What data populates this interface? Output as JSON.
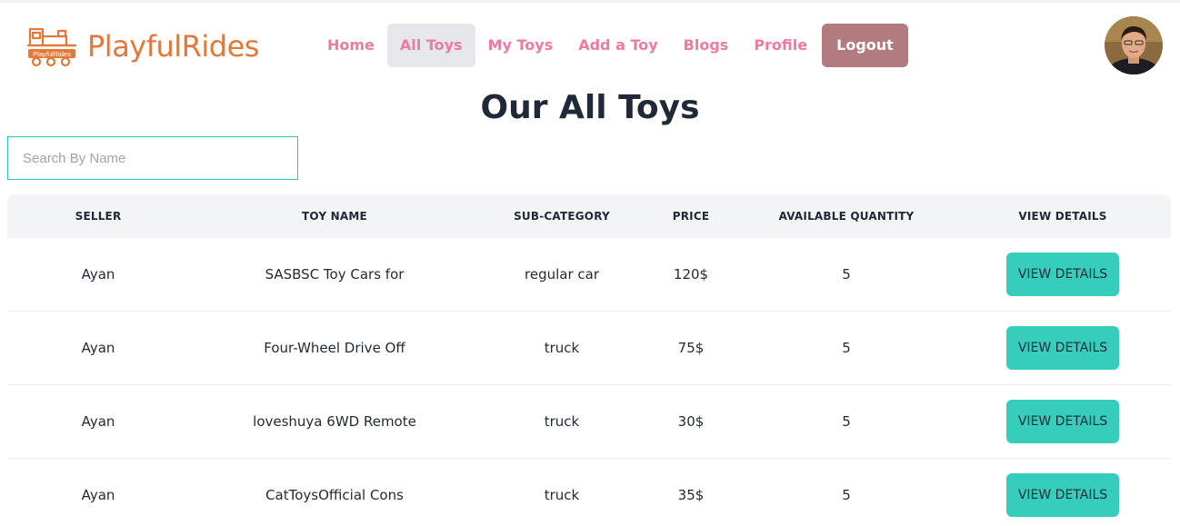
{
  "brand": {
    "name": "PlayfulRides",
    "logo_text": "PlayfulRides",
    "color": "#e2793b"
  },
  "nav": {
    "links": [
      {
        "label": "Home",
        "active": false
      },
      {
        "label": "All Toys",
        "active": true
      },
      {
        "label": "My Toys",
        "active": false
      },
      {
        "label": "Add a Toy",
        "active": false
      },
      {
        "label": "Blogs",
        "active": false
      },
      {
        "label": "Profile",
        "active": false
      }
    ],
    "logout_label": "Logout",
    "link_color": "#ee7aa1",
    "logout_color": "#b17b80"
  },
  "page": {
    "title": "Our All Toys"
  },
  "search": {
    "placeholder": "Search By Name",
    "value": ""
  },
  "table": {
    "headers": [
      "SELLER",
      "TOY NAME",
      "SUB-CATEGORY",
      "PRICE",
      "AVAILABLE QUANTITY",
      "VIEW DETAILS"
    ],
    "rows": [
      {
        "seller": "Ayan",
        "toy_name": "SASBSC Toy Cars for",
        "sub_category": "regular car",
        "price": "120$",
        "quantity": "5",
        "action": "VIEW DETAILS"
      },
      {
        "seller": "Ayan",
        "toy_name": "Four-Wheel Drive Off",
        "sub_category": "truck",
        "price": "75$",
        "quantity": "5",
        "action": "VIEW DETAILS"
      },
      {
        "seller": "Ayan",
        "toy_name": "loveshuya 6WD Remote",
        "sub_category": "truck",
        "price": "30$",
        "quantity": "5",
        "action": "VIEW DETAILS"
      },
      {
        "seller": "Ayan",
        "toy_name": "CatToysOfficial Cons",
        "sub_category": "truck",
        "price": "35$",
        "quantity": "5",
        "action": "VIEW DETAILS"
      }
    ],
    "button_color": "#36cdbd"
  }
}
